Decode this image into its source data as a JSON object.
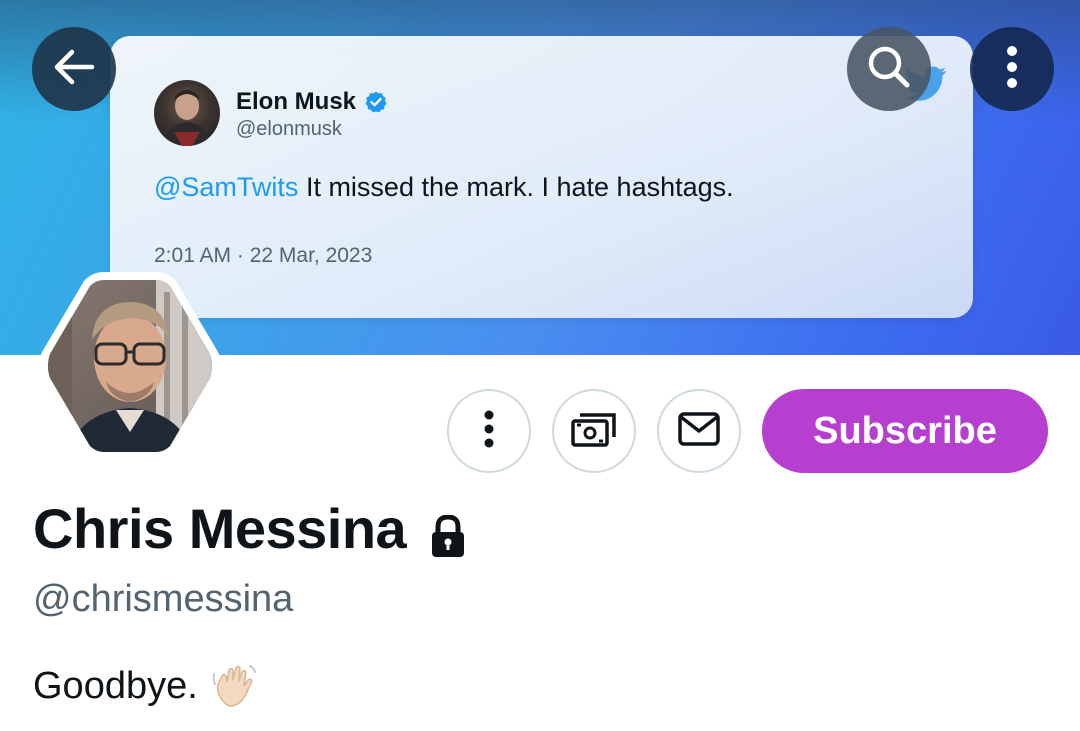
{
  "header": {
    "back_icon": "arrow-left-icon",
    "search_icon": "search-icon",
    "more_icon": "more-vertical-icon"
  },
  "banner": {
    "tweet": {
      "author_name": "Elon Musk",
      "author_handle": "@elonmusk",
      "verified_icon": "verified-badge-icon",
      "mention": "@SamTwits",
      "text": " It missed the mark. I hate hashtags.",
      "timestamp": "2:01 AM · 22 Mar, 2023",
      "logo_icon": "twitter-bird-icon"
    }
  },
  "profile": {
    "name": "Chris Messina",
    "protected_icon": "lock-icon",
    "handle": "@chrismessina",
    "bio": "Goodbye.",
    "bio_emoji": "waving-hand-icon"
  },
  "actions": {
    "more_icon": "more-vertical-icon",
    "tip_icon": "money-icon",
    "message_icon": "mail-icon",
    "subscribe_label": "Subscribe"
  },
  "colors": {
    "subscribe_bg": "#b73fd0",
    "mention": "#1d9bf0",
    "secondary_text": "#536471",
    "primary_text": "#0f1419",
    "button_border": "#cfd9de"
  }
}
